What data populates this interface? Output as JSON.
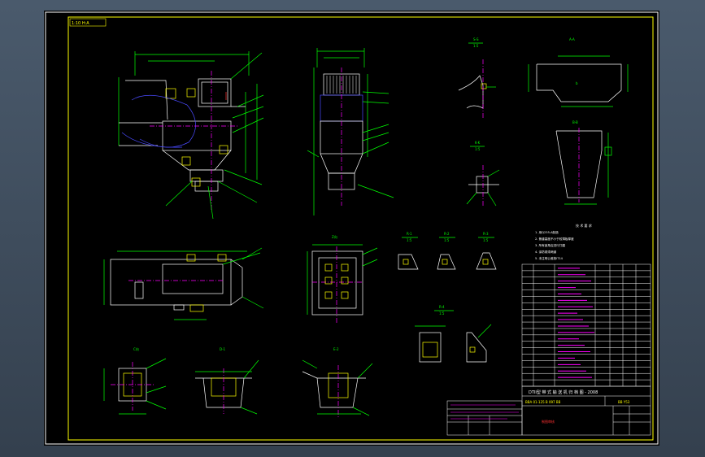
{
  "drawing": {
    "top_tag": "1:10 H:A",
    "title_block_line": "DTII型 带 式 输 送 机 归 档 图 - 2008",
    "title_block_code": "BBA 01-125 B 097 BB",
    "title_block_ref": "BB Y53",
    "sig_block_label": "制图审核",
    "tech_req_title": "技 术 要 求",
    "notes": [
      "1. 用Q235-A制造",
      "2. 焦缝高度不小于较薄板厚度",
      "3. 所有锁角应进行打磨",
      "4. 涂防锈漆两道",
      "5. 未注明公差按IT14"
    ]
  },
  "views": {
    "front": "",
    "side": "",
    "s1": "S-S",
    "s1_scale": "1:5",
    "k": "K-K",
    "k_scale": "1:5",
    "a": "A-A",
    "a_scale": "1:5",
    "b": "B-B",
    "b_scale": "1:5",
    "view_z": "Z向",
    "r1": "R-1",
    "r1s": "1:5",
    "r2": "R-2",
    "r2s": "1:5",
    "r3": "R-3",
    "r3s": "1:5",
    "r4": "R-4",
    "r4s": "1:5",
    "c": "C向",
    "d": "D-1",
    "e": "E-2"
  },
  "bom_rows": 19,
  "colors": {
    "frame": "#ffffff",
    "lines": "#ffffff",
    "dims": "#00ff00",
    "leader": "#00ff00",
    "accent_magenta": "#ff00ff",
    "accent_blue": "#4a4aff",
    "accent_yellow": "#ffff00",
    "accent_red": "#ff3030"
  }
}
